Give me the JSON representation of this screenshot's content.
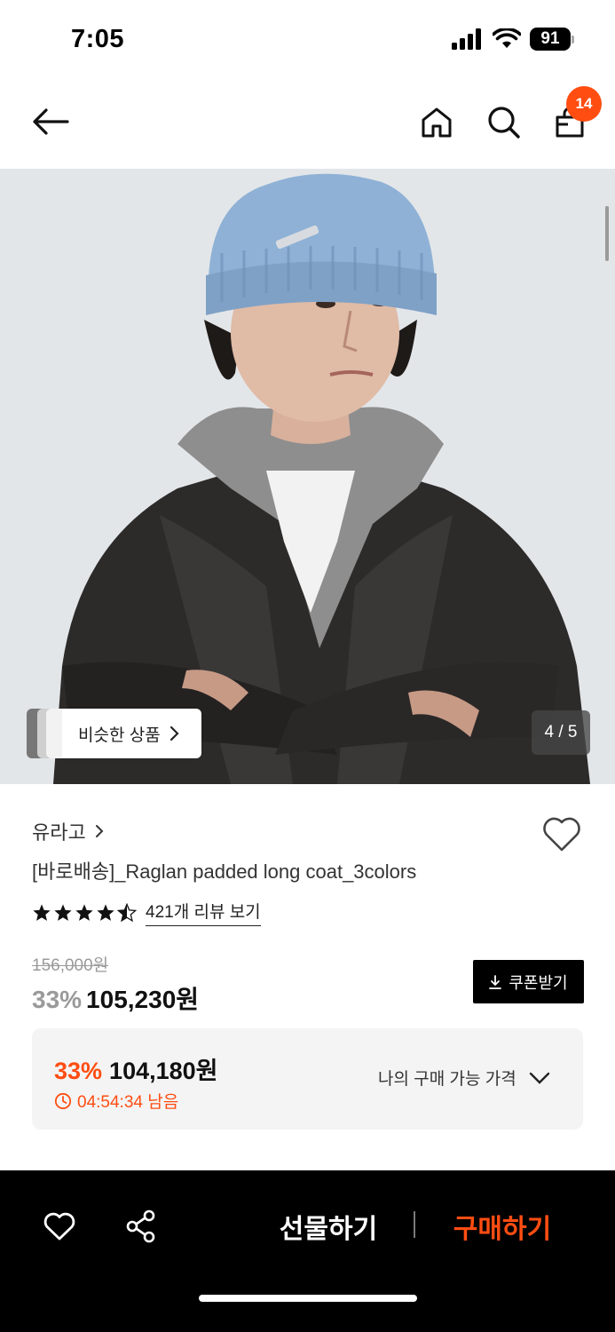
{
  "status_bar": {
    "time": "7:05",
    "battery": "91"
  },
  "nav": {
    "cart_count": "14"
  },
  "gallery": {
    "similar_label": "비슷한 상품",
    "page_counter": "4 / 5"
  },
  "product": {
    "brand": "유라고",
    "title": "[바로배송]_Raglan padded long coat_3colors",
    "rating": 4.5,
    "review_link": "421개 리뷰 보기",
    "original_price": "156,000원",
    "discount": "33%",
    "sale_price": "105,230원",
    "coupon_label": "쿠폰받기"
  },
  "best_price": {
    "discount": "33%",
    "price": "104,180원",
    "timer": "04:54:34 남음",
    "toggle_label": "나의 구매 가능 가격"
  },
  "bottom_bar": {
    "gift_label": "선물하기",
    "buy_label": "구매하기"
  },
  "colors": {
    "accent": "#ff4d12",
    "bar_bg": "#000000"
  }
}
